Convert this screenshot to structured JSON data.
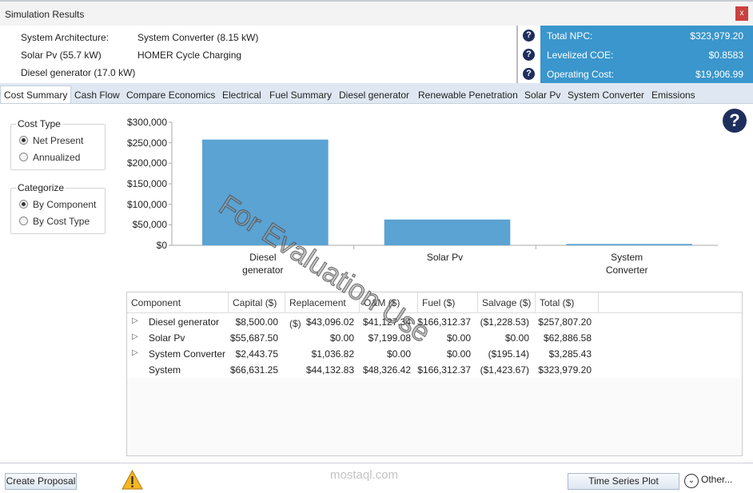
{
  "window": {
    "title": "Simulation Results",
    "close_label": "x"
  },
  "architecture": {
    "label": "System Architecture:",
    "items": [
      "System Converter (8.15 kW)",
      "Solar Pv (55.7 kW)",
      "HOMER Cycle Charging",
      "Diesel generator (17.0 kW)"
    ]
  },
  "kpi": [
    {
      "label": "Total NPC:",
      "value": "$323,979.20"
    },
    {
      "label": "Levelized COE:",
      "value": "$0.8583"
    },
    {
      "label": "Operating Cost:",
      "value": "$19,906.99"
    }
  ],
  "help_glyph": "?",
  "tabs": [
    "Cost Summary",
    "Cash Flow",
    "Compare Economics",
    "Electrical",
    "Fuel Summary",
    "Diesel generator",
    "Renewable Penetration",
    "Solar Pv",
    "System Converter",
    "Emissions"
  ],
  "cost_type": {
    "title": "Cost Type",
    "options": [
      "Net Present",
      "Annualized"
    ],
    "selected": "Net Present"
  },
  "categorize": {
    "title": "Categorize",
    "options": [
      "By Component",
      "By Cost Type"
    ],
    "selected": "By Component"
  },
  "chart_data": {
    "type": "bar",
    "categories": [
      "Diesel generator",
      "Solar Pv",
      "System Converter"
    ],
    "category_lines": [
      [
        "Diesel",
        "generator"
      ],
      [
        "Solar Pv"
      ],
      [
        "System",
        "Converter"
      ]
    ],
    "values": [
      257807.2,
      62886.58,
      3285.43
    ],
    "ylim": [
      0,
      300000
    ],
    "yticks": [
      "$0",
      "$50,000",
      "$100,000",
      "$150,000",
      "$200,000",
      "$250,000",
      "$300,000"
    ],
    "ytick_values": [
      0,
      50000,
      100000,
      150000,
      200000,
      250000,
      300000
    ],
    "color": "#5ba3d3",
    "grid": false
  },
  "table": {
    "headers": [
      "Component",
      "Capital ($)",
      "Replacement ($)",
      "O&M ($)",
      "Fuel ($)",
      "Salvage ($)",
      "Total ($)"
    ],
    "rows": [
      {
        "expandable": true,
        "cells": [
          "Diesel generator",
          "$8,500.00",
          "$43,096.02",
          "$41,127.34",
          "$166,312.37",
          "($1,228.53)",
          "$257,807.20"
        ]
      },
      {
        "expandable": true,
        "cells": [
          "Solar Pv",
          "$55,687.50",
          "$0.00",
          "$7,199.08",
          "$0.00",
          "$0.00",
          "$62,886.58"
        ]
      },
      {
        "expandable": true,
        "cells": [
          "System Converter",
          "$2,443.75",
          "$1,036.82",
          "$0.00",
          "$0.00",
          "($195.14)",
          "$3,285.43"
        ]
      },
      {
        "expandable": false,
        "cells": [
          "System",
          "$66,631.25",
          "$44,132.83",
          "$48,326.42",
          "$166,312.37",
          "($1,423.67)",
          "$323,979.20"
        ]
      }
    ]
  },
  "footer": {
    "create_proposal": "Create Proposal",
    "time_series": "Time Series Plot",
    "other": "Other..."
  },
  "watermarks": [
    "For Evaluation Use",
    "mostaql.com"
  ]
}
